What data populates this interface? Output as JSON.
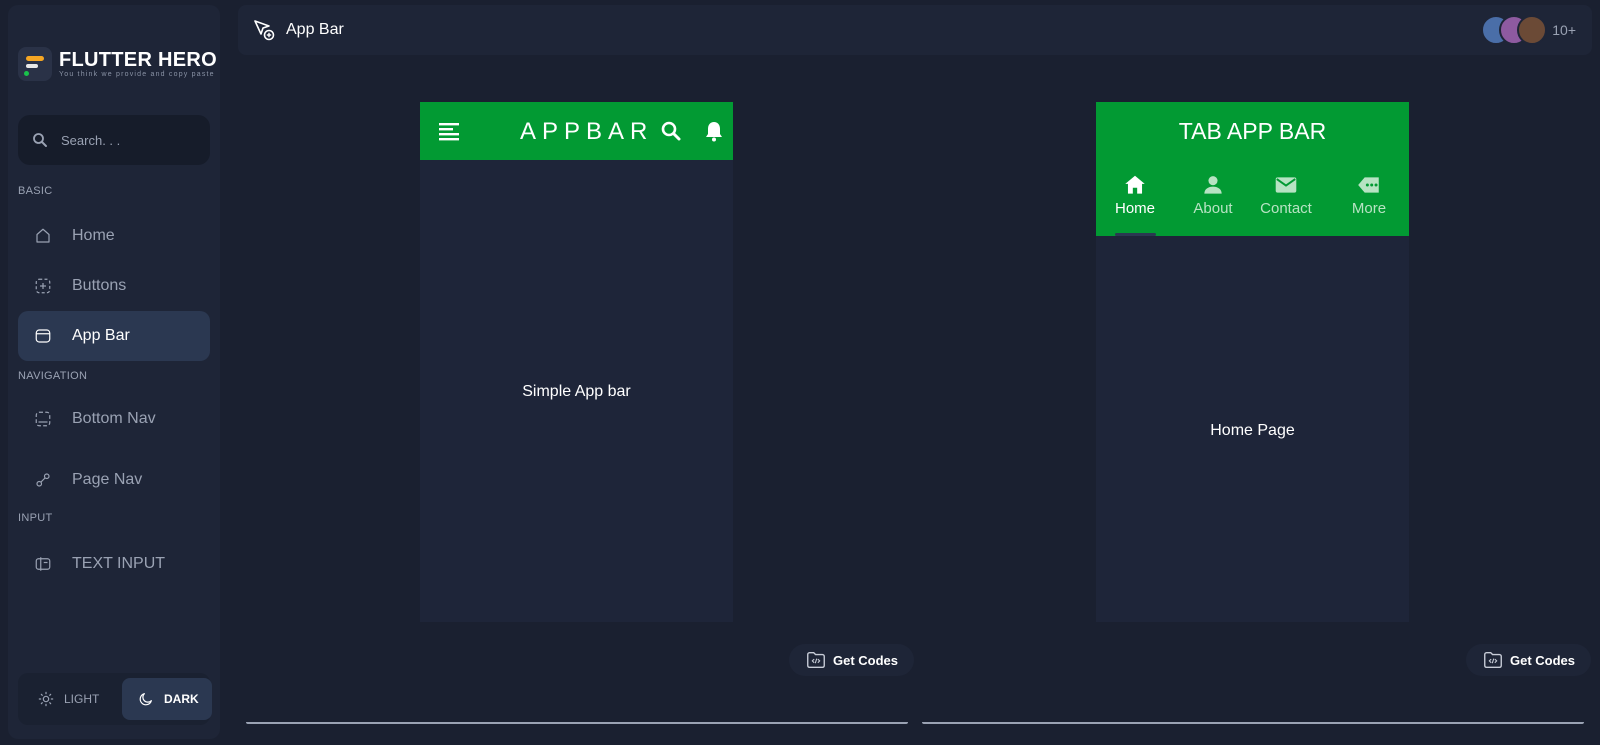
{
  "brand": {
    "title": "FLUTTER HERO",
    "subtitle": "You think we provide and copy paste"
  },
  "search": {
    "placeholder": "Search. . ."
  },
  "sidebar": {
    "sections": [
      {
        "label": "BASIC"
      },
      {
        "label": "NAVIGATION"
      },
      {
        "label": "INPUT"
      }
    ],
    "items": [
      {
        "label": "Home",
        "icon": "home-icon"
      },
      {
        "label": "Buttons",
        "icon": "button-icon"
      },
      {
        "label": "App Bar",
        "icon": "appbar-icon",
        "active": true
      },
      {
        "label": "Bottom Nav",
        "icon": "bottom-nav-icon"
      },
      {
        "label": "Page Nav",
        "icon": "page-nav-icon"
      },
      {
        "label": "TEXT INPUT",
        "icon": "text-input-icon"
      }
    ]
  },
  "theme": {
    "light_label": "LIGHT",
    "dark_label": "DARK",
    "selected": "DARK"
  },
  "topbar": {
    "title": "App Bar",
    "icon": "cursor-plus-icon",
    "avatar_count": "10+"
  },
  "demo1": {
    "appbar_title": "APPBAR",
    "body_text": "Simple App bar",
    "accent": "#029a33"
  },
  "demo2": {
    "appbar_title": "TAB APP BAR",
    "tabs": [
      {
        "label": "Home",
        "icon": "home-icon",
        "active": true
      },
      {
        "label": "About",
        "icon": "person-icon"
      },
      {
        "label": "Contact",
        "icon": "mail-icon"
      },
      {
        "label": "More",
        "icon": "more-icon"
      }
    ],
    "body_text": "Home Page"
  },
  "actions": {
    "get_codes_label": "Get Codes"
  }
}
